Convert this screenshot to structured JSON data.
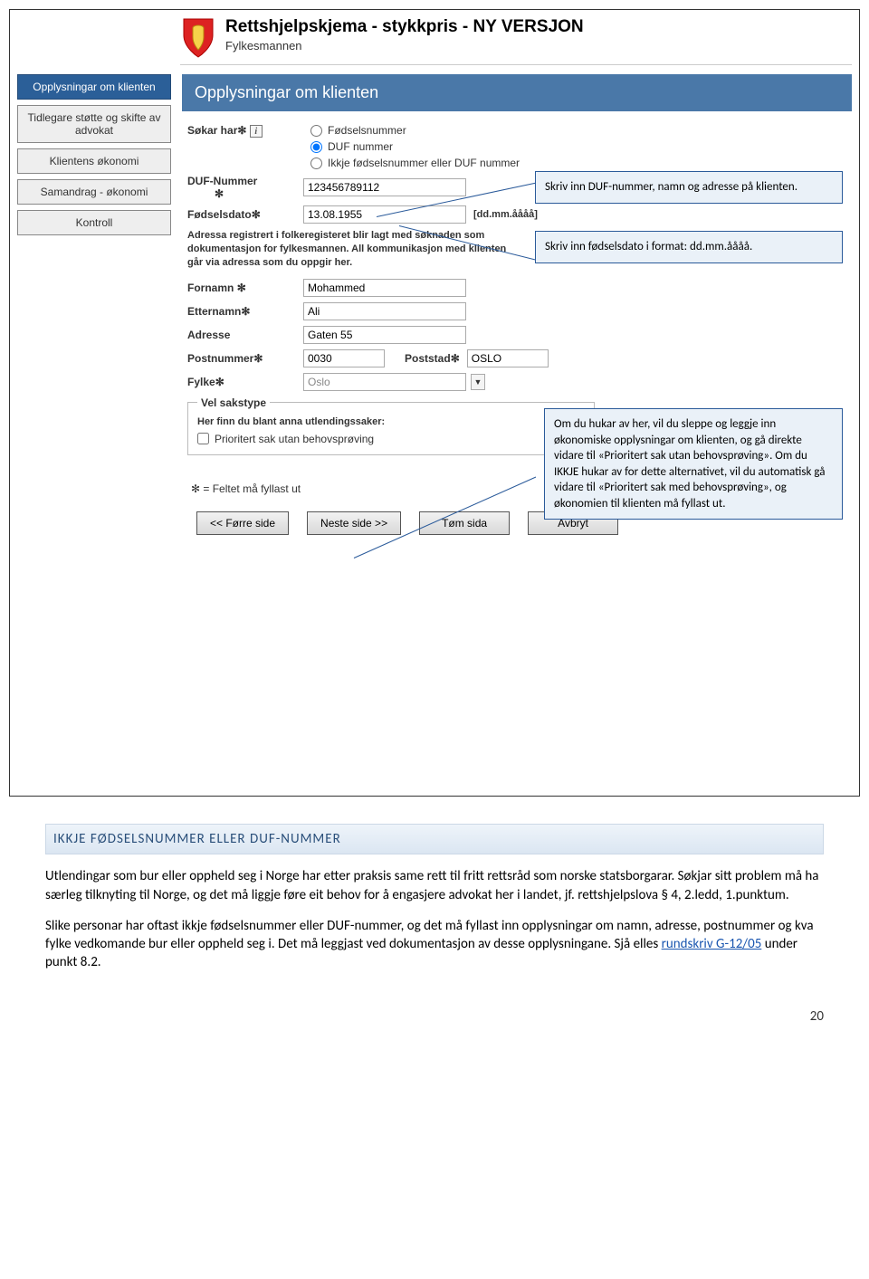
{
  "header": {
    "title": "Rettshjelpskjema - stykkpris - NY VERSJON",
    "subtitle": "Fylkesmannen"
  },
  "sidebar": {
    "items": [
      {
        "label": "Opplysningar om klienten",
        "active": true
      },
      {
        "label": "Tidlegare støtte og skifte av advokat",
        "active": false
      },
      {
        "label": "Klientens økonomi",
        "active": false
      },
      {
        "label": "Samandrag - økonomi",
        "active": false
      },
      {
        "label": "Kontroll",
        "active": false
      }
    ]
  },
  "section_title": "Opplysningar om klienten",
  "form": {
    "sokar_label": "Søkar har",
    "radio_options": {
      "fn": "Fødselsnummer",
      "duf": "DUF nummer",
      "none": "Ikkje fødselsnummer eller DUF nummer"
    },
    "duf_label": "DUF-Nummer",
    "duf_value": "123456789112",
    "dob_label": "Fødselsdato",
    "dob_value": "13.08.1955",
    "dob_hint": "[dd.mm.åååå]",
    "address_note": "Adressa registrert i folkeregisteret blir lagt med søknaden som dokumentasjon for fylkesmannen. All kommunikasjon med klienten går via adressa som du oppgir her.",
    "fornamn_label": "Fornamn",
    "fornamn_value": "Mohammed",
    "etternamn_label": "Etternamn",
    "etternamn_value": "Ali",
    "adresse_label": "Adresse",
    "adresse_value": "Gaten 55",
    "postnr_label": "Postnummer",
    "postnr_value": "0030",
    "poststad_label": "Poststad",
    "poststad_value": "OSLO",
    "fylke_label": "Fylke",
    "fylke_value": "Oslo",
    "vel_legend": "Vel sakstype",
    "vel_sub": "Her finn du blant anna utlendingssaker:",
    "vel_check": "Prioritert sak utan behovsprøving",
    "footnote": "✻ = Feltet må fyllast ut"
  },
  "buttons": {
    "prev": "<< Førre side",
    "next": "Neste side >>",
    "clear": "Tøm sida",
    "cancel": "Avbryt"
  },
  "callouts": {
    "c1": "Skriv inn DUF-nummer, namn og adresse på klienten.",
    "c2": "Skriv inn fødselsdato i format: dd.mm.åååå.",
    "c3": "Om du hukar av her, vil du sleppe og leggje inn økonomiske opplysningar om klienten, og gå direkte vidare til «Prioritert sak utan behovsprøving». Om du IKKJE hukar av for dette alternativet, vil du automatisk gå vidare til «Prioritert sak med behovsprøving», og økonomien til klienten må fyllast ut."
  },
  "doc": {
    "heading": "IKKJE FØDSELSNUMMER ELLER DUF-NUMMER",
    "p1": "Utlendingar som bur eller oppheld seg i Norge har etter praksis same rett til fritt rettsråd som norske statsborgarar. Søkjar sitt problem må ha særleg tilknyting til Norge, og det må liggje føre eit behov for å engasjere advokat her i landet, jf. rettshjelpslova § 4, 2.ledd, 1.punktum.",
    "p2_a": "Slike personar har oftast ikkje fødselsnummer eller DUF-nummer, og det må fyllast inn opplysningar om namn, adresse, postnummer og kva fylke vedkomande bur eller oppheld seg i. Det må leggjast ved dokumentasjon av desse opplysningane. Sjå elles ",
    "p2_link": "rundskriv G-12/05",
    "p2_b": " under punkt 8.2."
  },
  "page_number": "20"
}
